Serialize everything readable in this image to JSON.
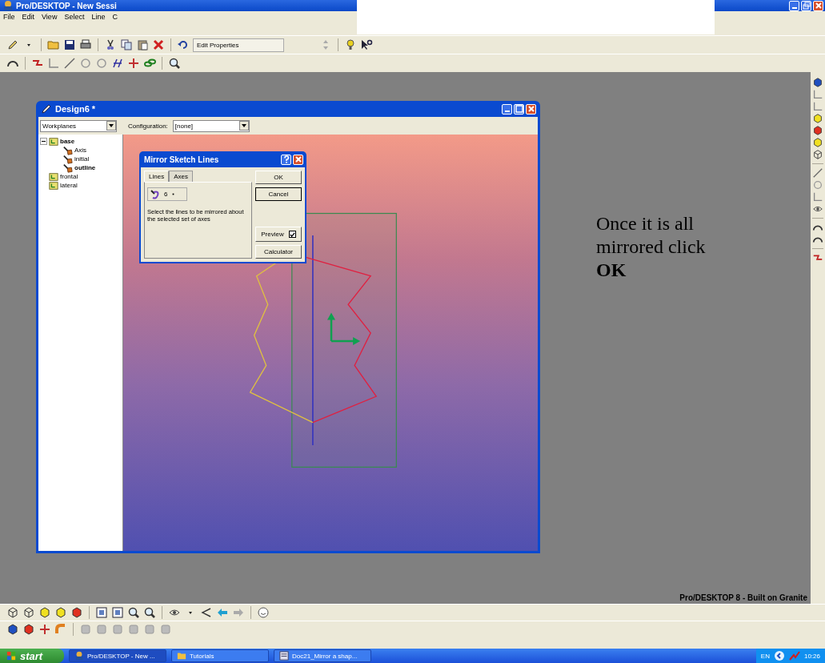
{
  "app_window": {
    "title": "Pro/DESKTOP - New Sessi",
    "menu": [
      "File",
      "Edit",
      "View",
      "Select",
      "Line",
      "C"
    ]
  },
  "toolbar": {
    "edit_field": "Edit Properties"
  },
  "design_window": {
    "title": "Design6 *",
    "view_dropdown": "Workplanes",
    "configuration_label": "Configuration:",
    "configuration_value": "[none]",
    "tree": [
      {
        "label": "base",
        "kind": "workplane",
        "active": true,
        "expanded": true,
        "children": [
          {
            "label": "Axis",
            "kind": "sketch",
            "active": false
          },
          {
            "label": "initial",
            "kind": "sketch",
            "active": false
          },
          {
            "label": "outline",
            "kind": "sketch",
            "active": true
          }
        ]
      },
      {
        "label": "frontal",
        "kind": "workplane",
        "active": false
      },
      {
        "label": "lateral",
        "kind": "workplane",
        "active": false
      }
    ]
  },
  "dialog": {
    "title": "Mirror Sketch Lines",
    "tabs": [
      {
        "label": "Lines",
        "selected": true
      },
      {
        "label": "Axes",
        "selected": false
      }
    ],
    "selection_count": "6",
    "instruction": "Select the lines to be mirrored about the selected set of axes",
    "buttons": [
      "OK",
      "Cancel"
    ],
    "preview": {
      "label": "Preview",
      "checked": true
    },
    "calculator": "Calculator"
  },
  "annotation": "Once it is all mirrored click **OK**",
  "status_text": "Pro/DESKTOP 8 - Built on Granite",
  "taskbar": {
    "start": "start",
    "tasks": [
      {
        "label": "Pro/DESKTOP - New ...",
        "selected": true
      },
      {
        "label": "Tutorials",
        "selected": false
      },
      {
        "label": "Doc21_Mirror a shap...",
        "selected": false
      }
    ],
    "language": "EN",
    "clock": "10:26"
  }
}
